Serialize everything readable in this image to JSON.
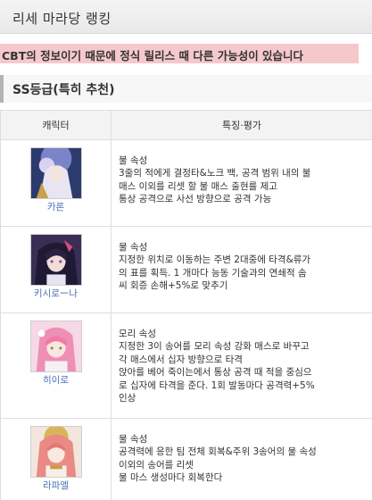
{
  "header": {
    "title": "리세 마라당 랭킹"
  },
  "notice": "CBT의 정보이기 때문에 정식 릴리스 때 다른 가능성이 있습니다",
  "section": {
    "title": "SS등급(특히 추천)"
  },
  "table": {
    "columns": [
      "캐릭터",
      "특징·평가"
    ],
    "rows": [
      {
        "name": "카론",
        "lines": [
          "불 속성",
          "3줄의 적에게 결정타&노크 백, 공격 범위 내의 불",
          "매스 이외를 리셋 할 불 매스 출현률 제고",
          "통상 공격으로 사선 방향으로 공격 가능"
        ]
      },
      {
        "name": "키시로ー나",
        "lines": [
          "물 속성",
          "지정한 위치로 이동하는 주변 2대중에 타격&류가",
          "의 표를 획득. 1 개마다 능동 기술과의 연쇄적 솜",
          "씨 회증 손해+5%로 맞추기"
        ]
      },
      {
        "name": "히이로",
        "lines": [
          "모리 속성",
          "지정한 3이 송어를 모리 속성 강화 매스로 바꾸고",
          "각 매스에서 십자 방향으로 타격",
          "앉아를 베어 죽이는에서 통상 공격 때 적을 중심으",
          "로 십자에 타격을 준다. 1회 발동마다 공격력+5%",
          "인상"
        ]
      },
      {
        "name": "라파엘",
        "lines": [
          "물 속성",
          "공격력에 응한 팀 전체 회복&주위 3송어의 물 속성",
          "이외의 송어를 리셋",
          "물 마스 생성마다 회복한다"
        ]
      }
    ]
  }
}
